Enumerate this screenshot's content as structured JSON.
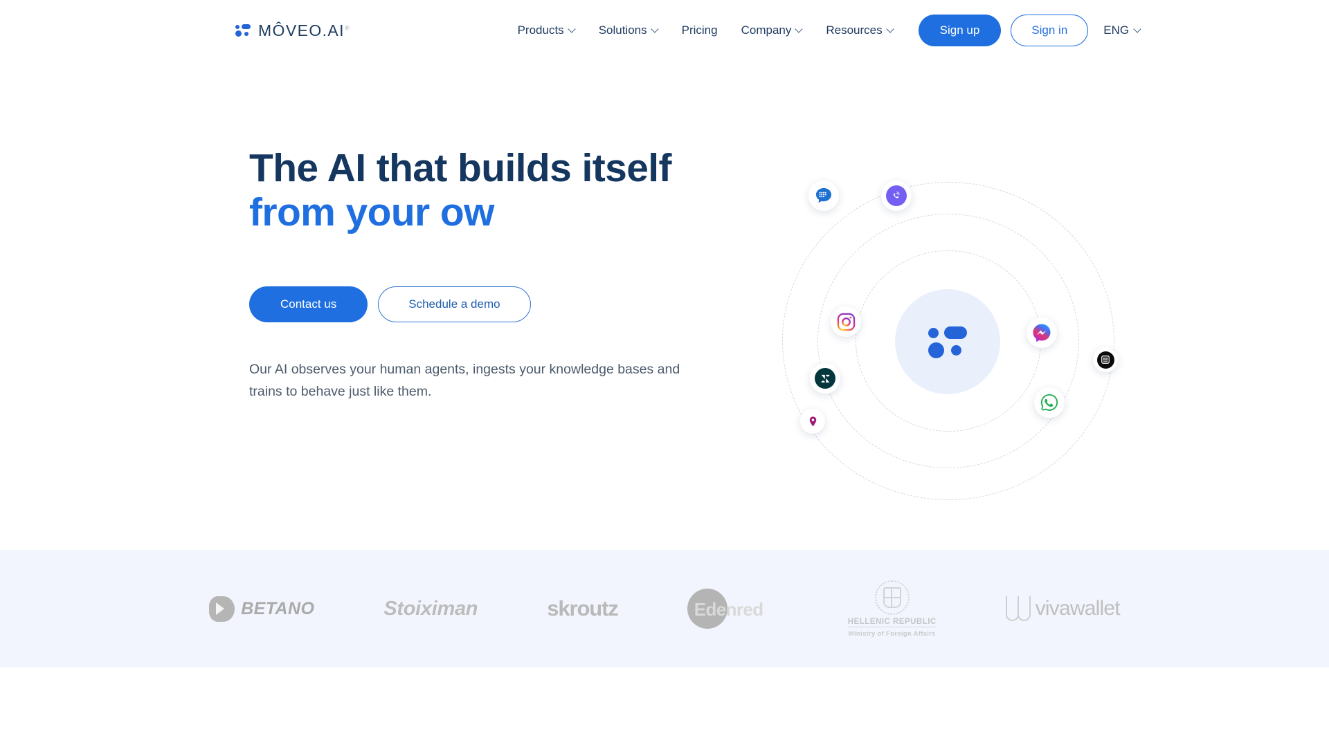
{
  "header": {
    "logo": {
      "text": "MÔVEO.AI",
      "trademark": "®",
      "mark_icon": "moveo-dots-icon"
    },
    "nav": [
      {
        "label": "Products",
        "has_dropdown": true,
        "icon": "chevron-down-icon"
      },
      {
        "label": "Solutions",
        "has_dropdown": true,
        "icon": "chevron-down-icon"
      },
      {
        "label": "Pricing",
        "has_dropdown": false,
        "icon": ""
      },
      {
        "label": "Company",
        "has_dropdown": true,
        "icon": "chevron-down-icon"
      },
      {
        "label": "Resources",
        "has_dropdown": true,
        "icon": "chevron-down-icon"
      }
    ],
    "sign_up_label": "Sign up",
    "sign_in_label": "Sign in",
    "language": {
      "label": "ENG",
      "icon": "chevron-down-icon"
    }
  },
  "hero": {
    "headline_dark": "The AI that builds itself ",
    "headline_blue": "from your ow",
    "cta_primary": "Contact us",
    "cta_secondary": "Schedule a demo",
    "subtitle": "Our AI observes your human agents, ingests your knowledge bases and trains to behave just like them.",
    "orbit": {
      "center_icon": "moveo-logo-icon",
      "nodes": [
        {
          "name": "rcs-messages-icon",
          "label": "RCS Messages"
        },
        {
          "name": "viber-icon",
          "label": "Viber"
        },
        {
          "name": "instagram-icon",
          "label": "Instagram"
        },
        {
          "name": "zendesk-icon",
          "label": "Zendesk"
        },
        {
          "name": "location-pin-icon",
          "label": "Location"
        },
        {
          "name": "messenger-icon",
          "label": "Messenger"
        },
        {
          "name": "whatsapp-icon",
          "label": "WhatsApp"
        },
        {
          "name": "barcode-app-icon",
          "label": "App"
        }
      ]
    }
  },
  "logo_band": {
    "logos": [
      {
        "name": "betano-logo",
        "text": "BETANO"
      },
      {
        "name": "stoiximan-logo",
        "text": "Stoiximan"
      },
      {
        "name": "skroutz-logo",
        "text": "skroutz"
      },
      {
        "name": "edenred-logo",
        "text": "Edenred"
      },
      {
        "name": "hellenic-republic-logo",
        "line1": "HELLENIC REPUBLIC",
        "line2": "Ministry of Foreign Affairs"
      },
      {
        "name": "vivawallet-logo",
        "text": "vivawallet"
      }
    ]
  },
  "colors": {
    "primary_blue": "#1f6fe0",
    "headline_navy": "#14365f",
    "band_background": "#f2f5fd",
    "body_text": "#4c5a6b"
  }
}
